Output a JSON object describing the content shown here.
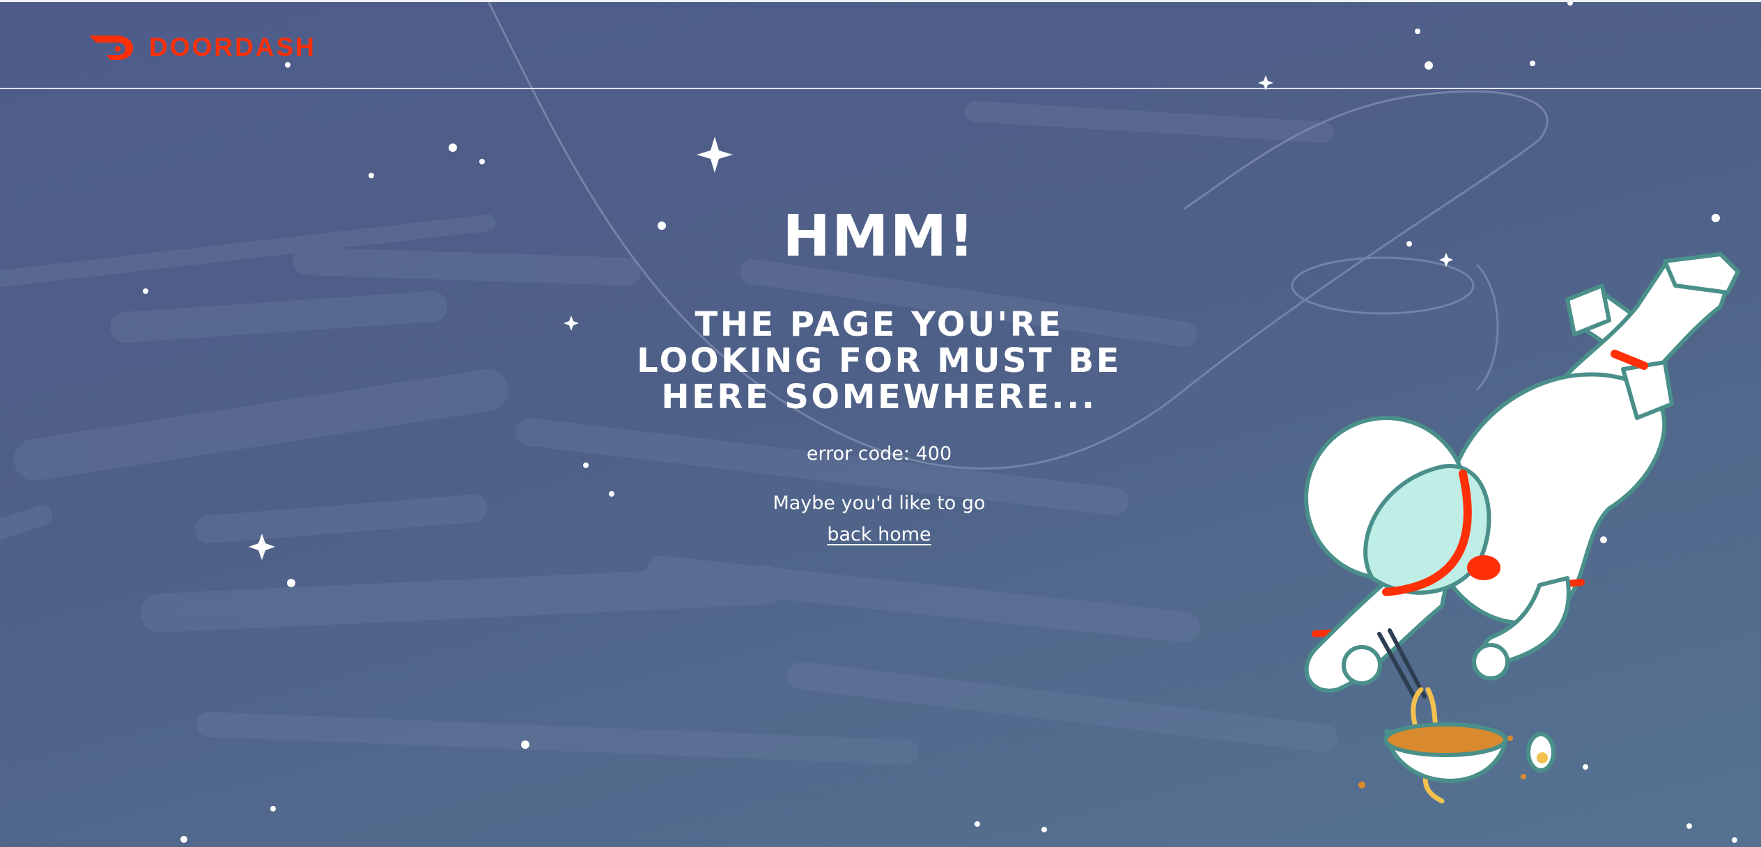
{
  "brand": {
    "name": "DOORDASH",
    "color": "#ff3008",
    "icon": "doordash-logo-icon"
  },
  "page": {
    "title": "HMM!",
    "subtitle_lines": [
      "THE PAGE YOU'RE",
      "LOOKING FOR MUST BE",
      "HERE SOMEWHERE..."
    ],
    "error_code": "error code: 400",
    "maybe_text": "Maybe you'd like to go",
    "back_home_label": "back home"
  },
  "colors": {
    "background": "#4f6088",
    "accent": "#ff3008",
    "text": "#ffffff"
  },
  "illustration": {
    "subject": "astronaut-eating-noodles-icon"
  }
}
